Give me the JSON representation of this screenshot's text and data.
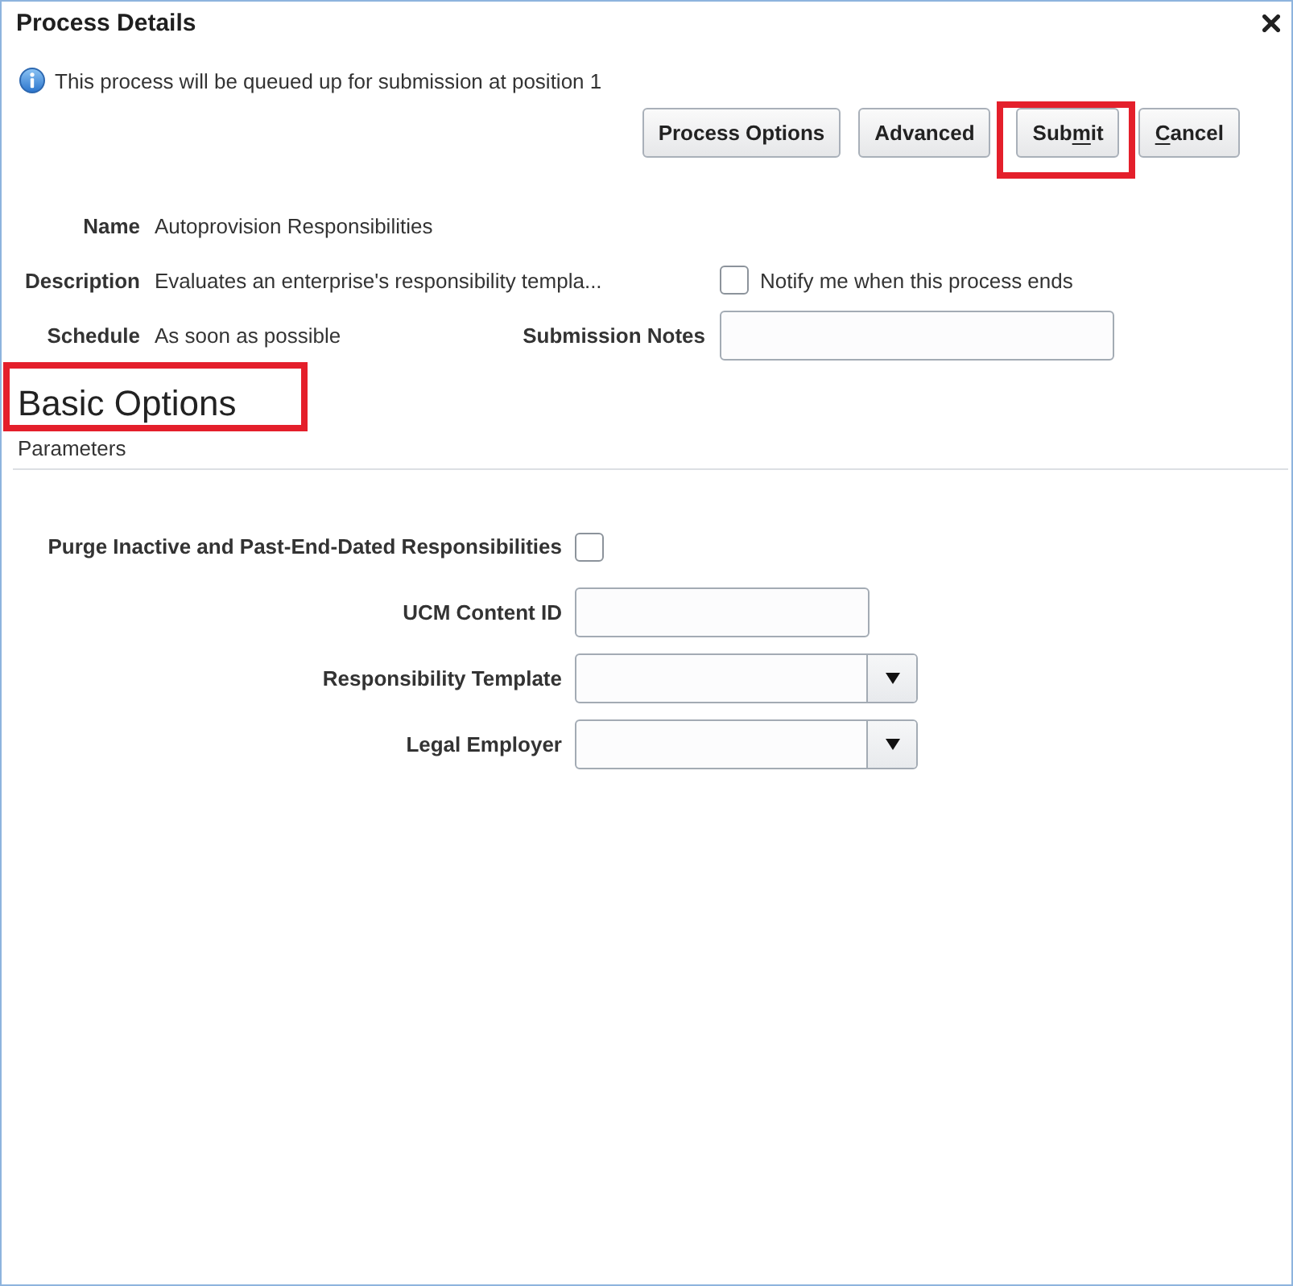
{
  "window": {
    "title": "Process Details"
  },
  "info_message": "This process will be queued up for submission at position 1",
  "buttons": [
    {
      "label_parts": [
        {
          "text": "Process Options",
          "underlined": false
        }
      ],
      "highlighted": false
    },
    {
      "label_parts": [
        {
          "text": "Advanced",
          "underlined": false
        }
      ],
      "highlighted": false
    },
    {
      "label_parts": [
        {
          "text": "Sub",
          "underlined": false
        },
        {
          "text": "m",
          "underlined": true
        },
        {
          "text": "it",
          "underlined": false
        }
      ],
      "highlighted": true
    },
    {
      "label_parts": [
        {
          "text": "C",
          "underlined": true
        },
        {
          "text": "ancel",
          "underlined": false
        }
      ],
      "highlighted": false
    }
  ],
  "summary": [
    {
      "label": "Name",
      "value": "Autoprovision Responsibilities"
    },
    {
      "label": "Description",
      "value": "Evaluates an enterprise's responsibility templa..."
    },
    {
      "label": "Schedule",
      "value": "As soon as possible"
    }
  ],
  "notify": {
    "label": "Notify me when this process ends",
    "checked": false
  },
  "submission_notes": {
    "label": "Submission Notes"
  },
  "section": {
    "title": "Basic Options",
    "highlighted": true
  },
  "parameters": {
    "title": "Parameters",
    "fields": [
      {
        "kind": "checkbox",
        "label": "Purge Inactive and Past-End-Dated Responsibilities",
        "checked": false
      },
      {
        "kind": "text",
        "label": "UCM Content ID"
      },
      {
        "kind": "select",
        "label": "Responsibility Template"
      },
      {
        "kind": "select",
        "label": "Legal Employer"
      }
    ]
  }
}
